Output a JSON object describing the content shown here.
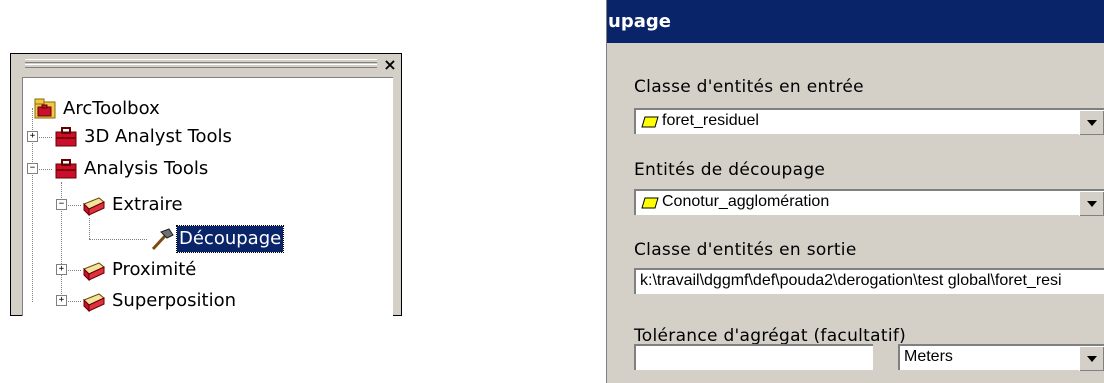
{
  "toolbox": {
    "close_glyph": "×",
    "root": "ArcToolbox",
    "items": [
      {
        "label": "3D Analyst Tools",
        "expander": "+"
      },
      {
        "label": "Analysis Tools",
        "expander": "−"
      },
      {
        "label": "Extraire",
        "expander": "−"
      },
      {
        "label": "Découpage",
        "expander": ""
      },
      {
        "label": "Proximité",
        "expander": "+"
      },
      {
        "label": "Superposition",
        "expander": "+"
      }
    ]
  },
  "dialog": {
    "title": "upage",
    "fields": {
      "input_class_label": "Classe d'entités en entrée",
      "input_class_value": "foret_residuel",
      "clip_features_label": "Entités de découpage",
      "clip_features_value": "Conotur_agglomération",
      "output_class_label": "Classe d'entités en sortie",
      "output_class_value": "k:\\travail\\dggmf\\def\\pouda2\\derogation\\test global\\foret_resi",
      "tolerance_label": "Tolérance d'agrégat (facultatif)",
      "tolerance_value": "",
      "units_value": "Meters"
    }
  },
  "colors": {
    "titlebar": "#0a246a",
    "panel": "#d4d0c8",
    "selection": "#0a246a",
    "layer_fill": "#ffff00"
  }
}
